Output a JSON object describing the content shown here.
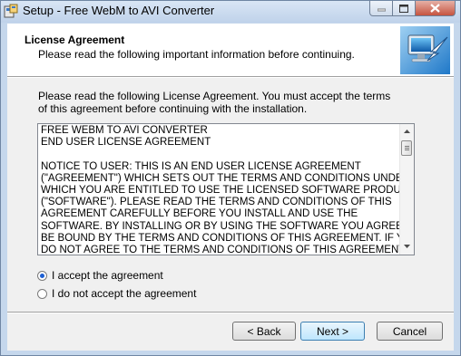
{
  "window": {
    "title": "Setup - Free WebM to AVI Converter"
  },
  "header": {
    "title": "License Agreement",
    "subtitle": "Please read the following important information before continuing."
  },
  "intro": "Please read the following License Agreement. You must accept the terms of this agreement before continuing with the installation.",
  "license_text": "FREE WEBM TO AVI CONVERTER\nEND USER LICENSE AGREEMENT\n\nNOTICE TO USER: THIS IS AN END USER LICENSE AGREEMENT\n(\"AGREEMENT\") WHICH SETS OUT THE TERMS AND CONDITIONS UNDER\nWHICH YOU ARE ENTITLED TO USE THE LICENSED SOFTWARE PRODUCT\n(\"SOFTWARE\"). PLEASE READ THE TERMS AND CONDITIONS OF THIS\nAGREEMENT CAREFULLY BEFORE YOU INSTALL AND USE THE\nSOFTWARE. BY INSTALLING OR BY USING THE SOFTWARE YOU AGREE TO\nBE BOUND BY THE TERMS AND CONDITIONS OF THIS AGREEMENT. IF YOU\nDO NOT AGREE TO THE TERMS AND CONDITIONS OF THIS AGREEMENT,",
  "options": {
    "accept": {
      "label": "I accept the agreement",
      "selected": true
    },
    "decline": {
      "label": "I do not accept the agreement",
      "selected": false
    }
  },
  "buttons": {
    "back": "< Back",
    "next": "Next >",
    "cancel": "Cancel"
  },
  "icons": {
    "app": "setup-installer-icon",
    "header": "computer-arrow-icon",
    "minimize": "minimize-icon",
    "maximize": "maximize-icon",
    "close": "close-icon",
    "scroll_up": "scroll-up-arrow-icon",
    "scroll_down": "scroll-down-arrow-icon"
  },
  "colors": {
    "accent_blue": "#1d5fd3",
    "close_red": "#c6533f",
    "title_bar": "#c5d7ec"
  }
}
